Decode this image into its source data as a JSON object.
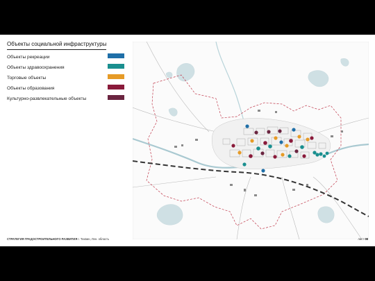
{
  "title": "Объекты социальной инфраструктуры",
  "legend": [
    {
      "label": "Объекты рекреации",
      "color": "#1f6fa8"
    },
    {
      "label": "Объекты здравоохранения",
      "color": "#1a8f8f"
    },
    {
      "label": "Торговые объекты",
      "color": "#e69b27"
    },
    {
      "label": "Объекты образования",
      "color": "#8a1a3a"
    },
    {
      "label": "Культурно-развлекательные объекты",
      "color": "#6b2540"
    }
  ],
  "footer": {
    "strategy": "СТРАТЕГИЯ ГРАДОСТРОИТЕЛЬНОГО РАЗВИТИЯ",
    "location": "г. Тихвин, Лен. область"
  },
  "page": {
    "label": "лист",
    "number": "08"
  }
}
